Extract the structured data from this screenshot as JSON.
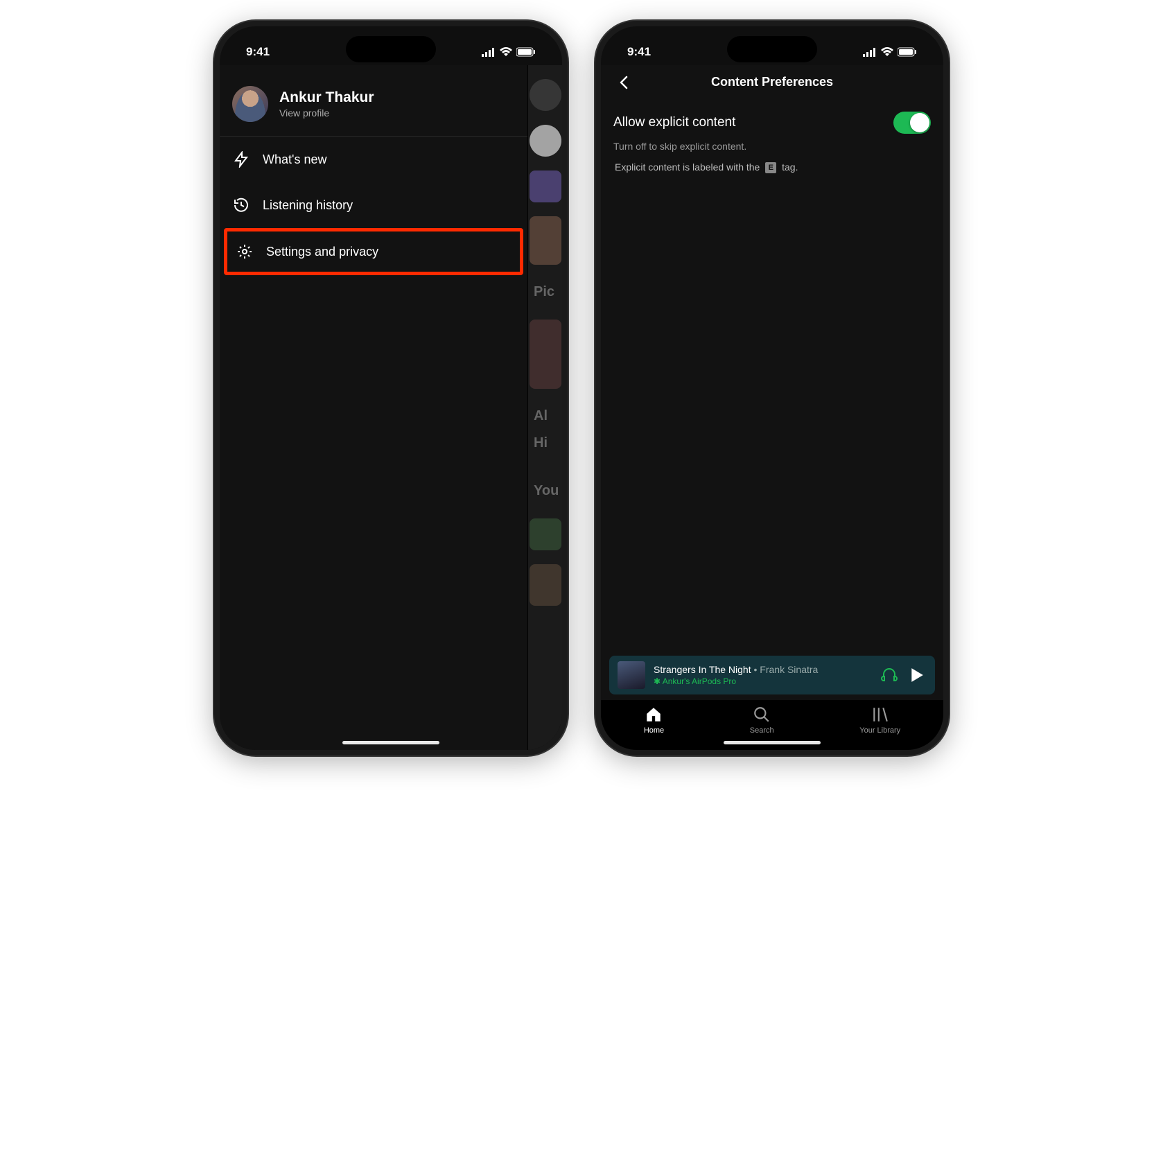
{
  "status": {
    "time": "9:41"
  },
  "left": {
    "profile": {
      "name": "Ankur Thakur",
      "subtitle": "View profile"
    },
    "menu": {
      "whats_new": "What's new",
      "listening_history": "Listening history",
      "settings_privacy": "Settings and privacy"
    },
    "peek": {
      "picked": "Pic",
      "al": "Al",
      "hi": "Hi",
      "your": "You"
    }
  },
  "right": {
    "header": {
      "title": "Content Preferences"
    },
    "setting": {
      "title": "Allow explicit content",
      "subtitle": "Turn off to skip explicit content.",
      "line2_pre": "Explicit content is labeled with the",
      "line2_tag": "E",
      "line2_post": " tag."
    },
    "now_playing": {
      "track": "Strangers In The Night",
      "separator": " • ",
      "artist": "Frank Sinatra",
      "device_prefix": "✱ ",
      "device": "Ankur's AirPods Pro"
    },
    "tabs": {
      "home": "Home",
      "search": "Search",
      "library": "Your Library"
    }
  }
}
